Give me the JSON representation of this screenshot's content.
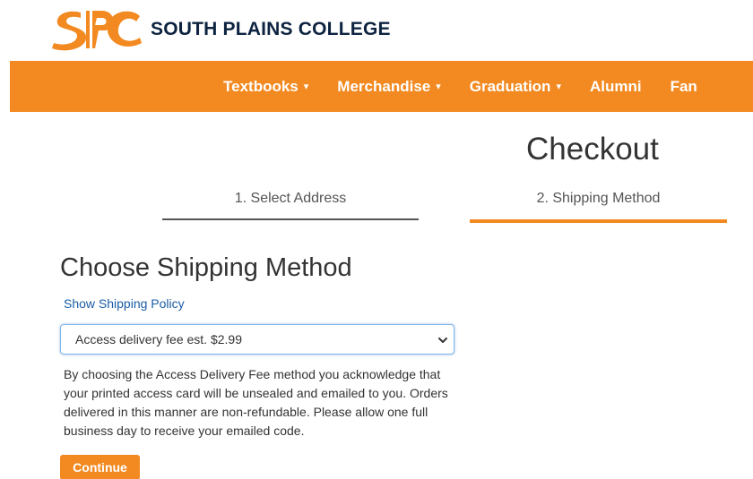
{
  "brand": {
    "name": "SOUTH PLAINS COLLEGE",
    "logo_icon": "spc-logo-icon",
    "primary_color": "#f28a21",
    "navy_color": "#0d2340"
  },
  "nav": {
    "items": [
      {
        "label": "Textbooks",
        "caret": "▾",
        "has_dropdown": true
      },
      {
        "label": "Merchandise",
        "caret": "▾",
        "has_dropdown": true
      },
      {
        "label": "Graduation",
        "caret": "▾",
        "has_dropdown": true
      },
      {
        "label": "Alumni",
        "caret": "",
        "has_dropdown": false
      },
      {
        "label": "Fan",
        "caret": "",
        "has_dropdown": false
      }
    ]
  },
  "checkout": {
    "title": "Checkout",
    "steps": [
      {
        "label": "1. Select Address",
        "active": false
      },
      {
        "label": "2. Shipping Method",
        "active": true
      }
    ]
  },
  "shipping": {
    "title": "Choose Shipping Method",
    "policy_link": "Show Shipping Policy",
    "selected_option": "Access delivery fee est. $2.99",
    "dropdown_icon": "chevron-down-icon",
    "description": "By choosing the Access Delivery Fee method you acknowledge that your printed access card will be unsealed and emailed to you. Orders delivered in this manner are non-refundable. Please allow one full business day to receive your emailed code.",
    "continue_label": "Continue"
  }
}
